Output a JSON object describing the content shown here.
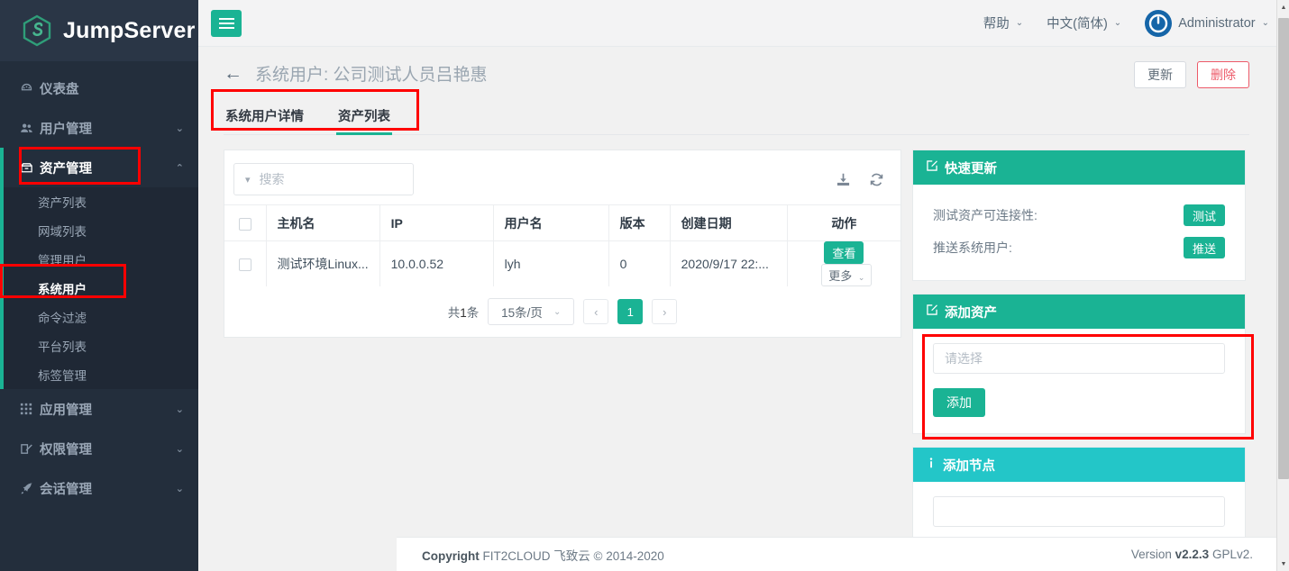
{
  "brand": {
    "name": "JumpServer",
    "logo_icon": "jumpserver-logo-icon",
    "accent": "#1ab394",
    "sidebar_bg": "#232e3c"
  },
  "sidebar": {
    "items": [
      {
        "label": "仪表盘",
        "icon": "dashboard-icon",
        "chevron": "",
        "active": false
      },
      {
        "label": "用户管理",
        "icon": "users-icon",
        "chevron": "⌄",
        "active": false
      },
      {
        "label": "资产管理",
        "icon": "asset-box-icon",
        "chevron": "⌃",
        "active": true
      },
      {
        "label": "应用管理",
        "icon": "grid-apps-icon",
        "chevron": "⌄",
        "active": false
      },
      {
        "label": "权限管理",
        "icon": "edit-permission-icon",
        "chevron": "⌄",
        "active": false
      },
      {
        "label": "会话管理",
        "icon": "rocket-session-icon",
        "chevron": "⌄",
        "active": false
      }
    ],
    "submenu": [
      {
        "label": "资产列表",
        "current": false
      },
      {
        "label": "网域列表",
        "current": false
      },
      {
        "label": "管理用户",
        "current": false
      },
      {
        "label": "系统用户",
        "current": true
      },
      {
        "label": "命令过滤",
        "current": false
      },
      {
        "label": "平台列表",
        "current": false
      },
      {
        "label": "标签管理",
        "current": false
      }
    ]
  },
  "topbar": {
    "menu_toggle_icon": "hamburger-icon",
    "help": {
      "label": "帮助",
      "chevron": "⌄"
    },
    "language": {
      "label": "中文(简体)",
      "chevron": "⌄"
    },
    "user": {
      "label": "Administrator",
      "chevron": "⌄",
      "avatar_icon": "user-avatar-icon"
    }
  },
  "page": {
    "back_icon": "back-arrow-icon",
    "title": "系统用户: 公司测试人员吕艳惠",
    "buttons": {
      "update": "更新",
      "delete": "删除"
    },
    "tabs": [
      {
        "label": "系统用户详情",
        "active": false
      },
      {
        "label": "资产列表",
        "active": true
      }
    ]
  },
  "table_panel": {
    "search": {
      "placeholder": "搜索",
      "chevron_icon": "chevron-down-icon",
      "value": ""
    },
    "tools": [
      {
        "icon": "download-icon"
      },
      {
        "icon": "refresh-icon"
      }
    ],
    "columns": [
      "主机名",
      "IP",
      "用户名",
      "版本",
      "创建日期",
      "动作"
    ],
    "rows": [
      {
        "hostname": "测试环境Linux...",
        "ip": "10.0.0.52",
        "username": "lyh",
        "version": "0",
        "created": "2020/9/17 22:...",
        "actions": {
          "view": "查看",
          "more": "更多",
          "more_chevron": "⌄"
        }
      }
    ],
    "pagination": {
      "total_prefix": "共",
      "total_count": "1",
      "total_suffix": "条",
      "page_size": "15条/页",
      "page_size_chevron": "⌄",
      "prev": "‹",
      "next": "›",
      "current_page": "1"
    }
  },
  "right_cards": [
    {
      "title": "快速更新",
      "icon": "edit-square-icon",
      "header_color": "#1ab394",
      "rows": [
        {
          "label": "测试资产可连接性:",
          "button": "测试"
        },
        {
          "label": "推送系统用户:",
          "button": "推送"
        }
      ]
    },
    {
      "title": "添加资产",
      "icon": "edit-square-icon",
      "header_color": "#1ab394",
      "select_placeholder": "请选择",
      "add_button": "添加"
    },
    {
      "title": "添加节点",
      "icon": "info-icon",
      "header_color": "#23c6c8"
    }
  ],
  "footer": {
    "copyright_bold": "Copyright",
    "copyright_text": "FIT2CLOUD 飞致云 © 2014-2020",
    "version_prefix": "Version",
    "version_number": "v2.2.3",
    "version_suffix": "GPLv2."
  },
  "scrollbar": {
    "up_icon": "scroll-up-arrow-icon",
    "down_icon": "scroll-down-arrow-icon"
  }
}
